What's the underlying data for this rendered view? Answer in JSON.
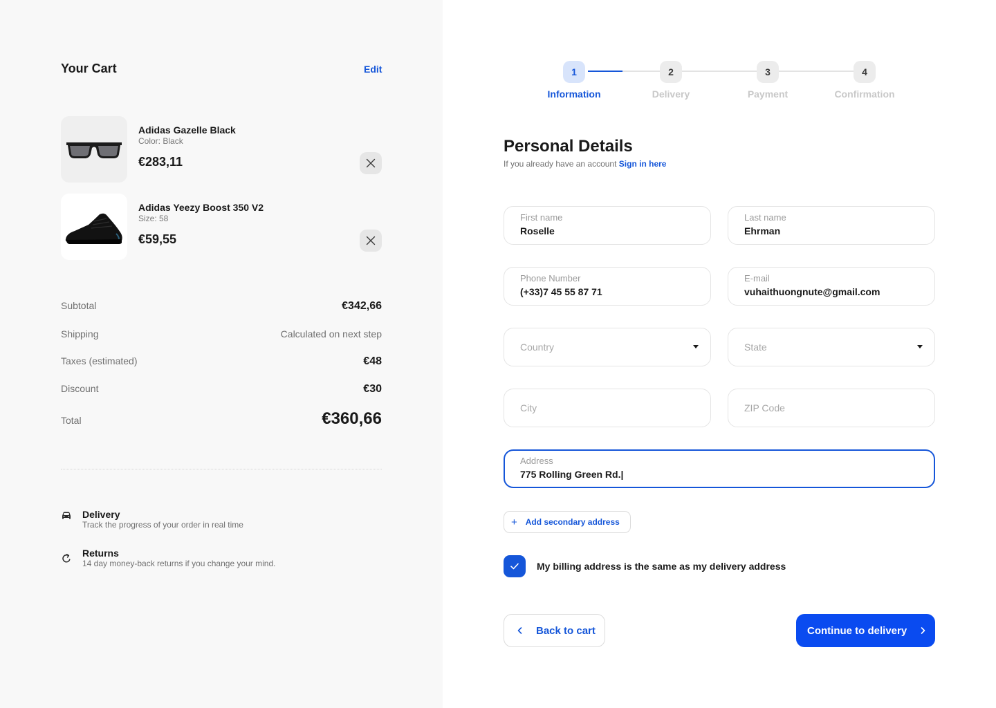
{
  "cart": {
    "title": "Your Cart",
    "edit_label": "Edit",
    "items": [
      {
        "name": "Adidas Gazelle Black",
        "meta": "Color: Black",
        "price": "€283,11",
        "thumbnail": "sunglasses"
      },
      {
        "name": "Adidas Yeezy Boost 350 V2",
        "meta": "Size: 58",
        "price": "€59,55",
        "thumbnail": "sneaker"
      }
    ],
    "summary": {
      "subtotal_label": "Subtotal",
      "subtotal_value": "€342,66",
      "shipping_label": "Shipping",
      "shipping_value": "Calculated on next step",
      "taxes_label": "Taxes (estimated)",
      "taxes_value": "€48",
      "discount_label": "Discount",
      "discount_value": "€30",
      "total_label": "Total",
      "total_value": "€360,66"
    },
    "perks": [
      {
        "title": "Delivery",
        "desc": "Track the progress of your order in real time",
        "icon": "car-icon"
      },
      {
        "title": "Returns",
        "desc": "14 day money-back returns if you change your mind.",
        "icon": "refresh-icon"
      }
    ]
  },
  "stepper": {
    "current": 1,
    "steps": [
      {
        "number": "1",
        "label": "Information"
      },
      {
        "number": "2",
        "label": "Delivery"
      },
      {
        "number": "3",
        "label": "Payment"
      },
      {
        "number": "4",
        "label": "Confirmation"
      }
    ]
  },
  "form": {
    "title": "Personal Details",
    "subtitle": "If you already have an account",
    "signin_label": "Sign in here",
    "first_name": {
      "label": "First name",
      "value": "Roselle"
    },
    "last_name": {
      "label": "Last name",
      "value": "Ehrman"
    },
    "phone": {
      "label": "Phone Number",
      "value": "(+33)7 45 55 87 71"
    },
    "email": {
      "label": "E-mail",
      "value": "vuhaithuongnute@gmail.com"
    },
    "country": {
      "placeholder": "Country"
    },
    "state": {
      "placeholder": "State"
    },
    "city": {
      "placeholder": "City"
    },
    "zip": {
      "placeholder": "ZIP Code"
    },
    "address": {
      "label": "Address",
      "value": "775 Rolling Green Rd.|"
    },
    "secondary_address_label": "Add secondary address",
    "billing_same_label": "My billing address is the same as my delivery address",
    "billing_same_checked": true,
    "back_label": "Back to cart",
    "continue_label": "Continue to delivery"
  },
  "colors": {
    "accent": "#1556d9",
    "primary_button": "#0a4bf0",
    "panel_bg": "#f8f8f8"
  }
}
